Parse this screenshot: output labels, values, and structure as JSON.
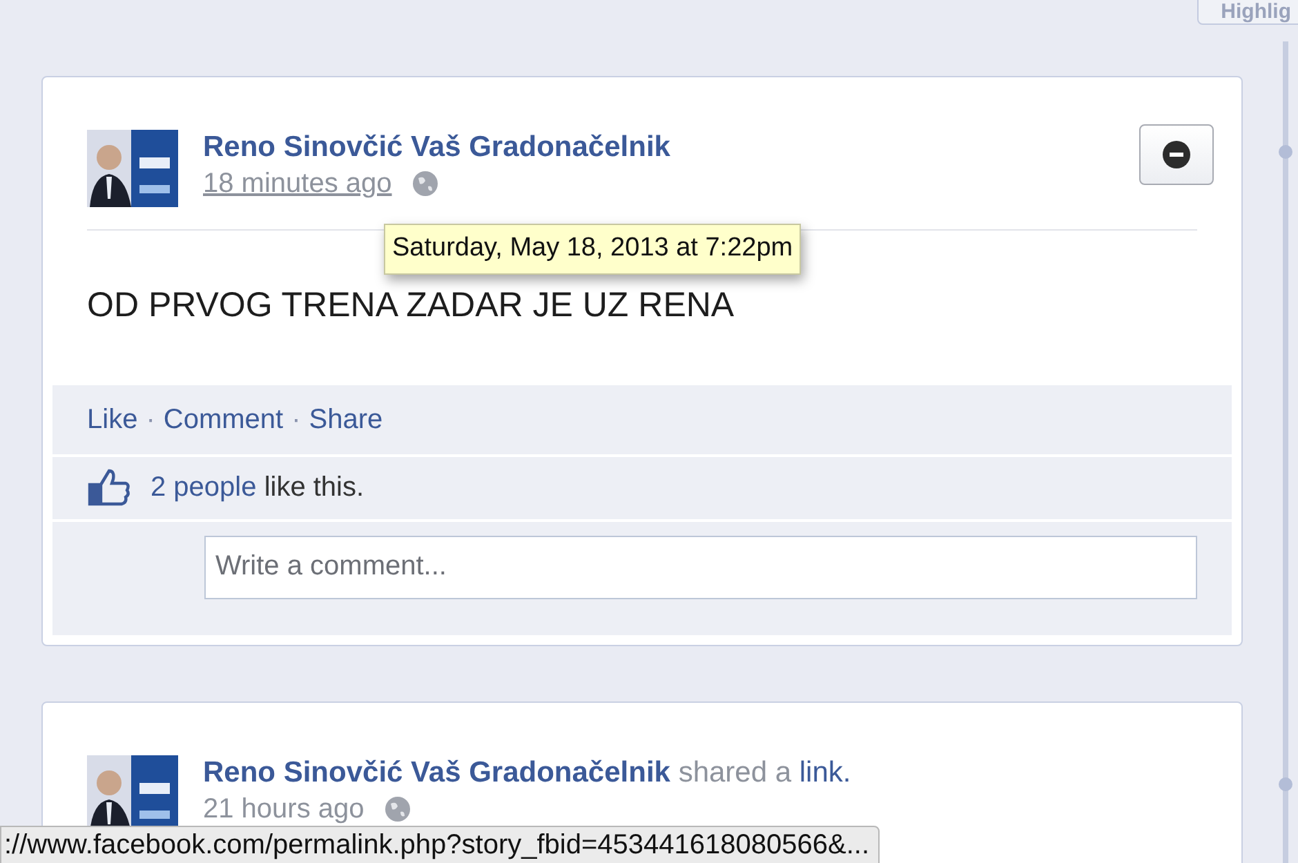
{
  "top_button": {
    "label": "Highlig"
  },
  "posts": [
    {
      "author": "Reno Sinovčić Vaš Gradonačelnik",
      "time": "18 minutes ago",
      "tooltip": "Saturday, May 18, 2013 at 7:22pm",
      "text": "OD PRVOG TRENA ZADAR JE UZ RENA",
      "actions": [
        "Like",
        "Comment",
        "Share"
      ],
      "separator": "·",
      "likes_link": "2 people",
      "likes_rest": "like this.",
      "comment_placeholder": "Write a comment..."
    },
    {
      "author": "Reno Sinovčić Vaš Gradonačelnik",
      "action_prefix": "shared a",
      "action_link": "link.",
      "time": "21 hours ago"
    }
  ],
  "status_bar": "://www.facebook.com/permalink.php?story_fbid=453441618080566&..."
}
